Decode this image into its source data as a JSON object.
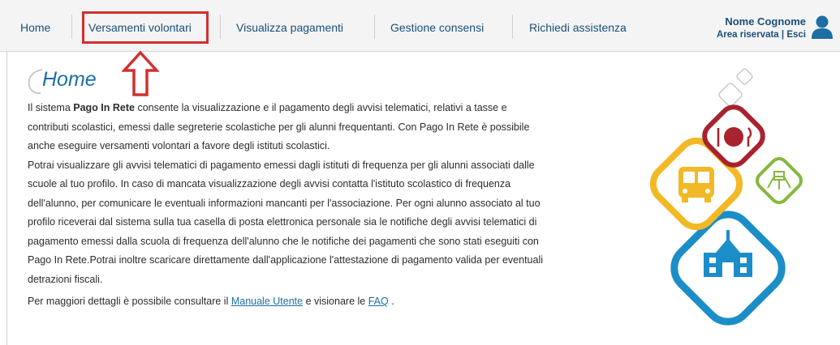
{
  "nav": {
    "items": [
      {
        "label": "Home"
      },
      {
        "label": "Versamenti volontari"
      },
      {
        "label": "Visualizza pagamenti"
      },
      {
        "label": "Gestione consensi"
      },
      {
        "label": "Richiedi assistenza"
      }
    ]
  },
  "user": {
    "name": "Nome Cognome",
    "area_label": "Area riservata",
    "divider": "|",
    "logout_label": "Esci"
  },
  "page": {
    "title": "Home",
    "p1_before": "Il sistema ",
    "p1_bold": "Pago In Rete",
    "p1_line1_after": " consente la visualizzazione e il pagamento degli avvisi telematici, relativi a tasse e",
    "p1_line2": "contributi scolastici, emessi dalle segreterie scolastiche per gli alunni frequentanti. Con Pago In Rete è possibile",
    "p1_line3": "anche eseguire versamenti volontari a favore degli istituti scolastici.",
    "p2_line1": "Potrai visualizzare gli avvisi telematici di pagamento emessi dagli istituti di frequenza per gli alunni associati dalle",
    "p2_line2": "scuole al tuo profilo. In caso di mancata visualizzazione degli avvisi contatta l'istituto scolastico di frequenza",
    "p2_line3": "dell'alunno, per comunicare le eventuali informazioni mancanti per l'associazione. Per ogni alunno associato al tuo",
    "p2_line4": "profilo riceverai dal sistema sulla tua casella di posta elettronica personale sia le notifiche degli avvisi telematici di",
    "p2_line5": "pagamento emessi dalla scuola di frequenza dell'alunno che le notifiche dei pagamenti che sono stati eseguiti con",
    "p2_line6": "Pago In Rete.Potrai inoltre scaricare direttamente dall'applicazione l'attestazione di pagamento valida per eventuali",
    "p2_line7": "detrazioni fiscali.",
    "p3_before": "Per maggiori dettagli è possibile consultare il ",
    "p3_link1": "Manuale Utente",
    "p3_middle": " e visionare le ",
    "p3_link2": "FAQ",
    "p3_after": " ."
  },
  "colors": {
    "accent_red": "#d32f2f",
    "link_blue": "#1c6ea4",
    "food_red": "#a8232e",
    "bus_yellow": "#f2b926",
    "park_green": "#86b83f",
    "school_blue": "#1b8ec8"
  },
  "icons": [
    "user-avatar-icon",
    "up-arrow-icon",
    "food-icon",
    "school-bus-icon",
    "playground-icon",
    "school-building-icon"
  ]
}
